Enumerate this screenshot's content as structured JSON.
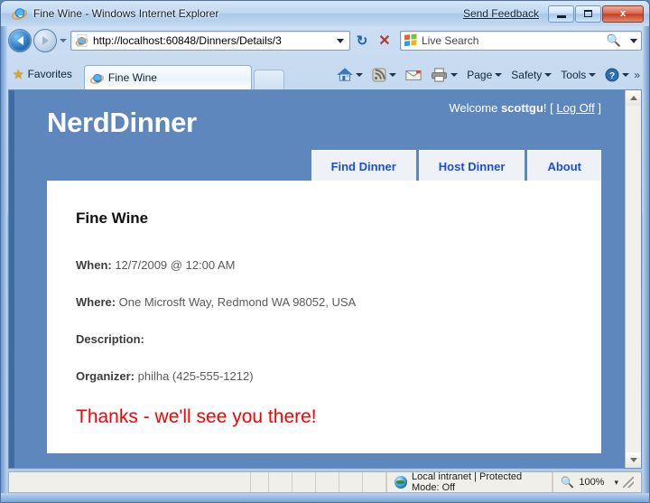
{
  "window": {
    "title": "Fine Wine - Windows Internet Explorer",
    "title_icon": "ie-logo-icon",
    "send_feedback": "Send Feedback",
    "minimize_label": "Minimize",
    "maximize_label": "Maximize",
    "close_label": "x"
  },
  "navigation": {
    "back_label": "Back",
    "forward_label": "Forward",
    "history_label": "Recent Pages",
    "address_value": "http://localhost:60848/Dinners/Details/3",
    "address_placeholder": "http://",
    "refresh_label": "↻",
    "stop_label": "✕",
    "search_placeholder": "Live Search",
    "search_value": "Live Search"
  },
  "tabbar": {
    "favorites_label": "Favorites",
    "tab_title": "Fine Wine",
    "new_tab_label": "",
    "commands": [
      {
        "label": "",
        "icon": "home-icon",
        "caret": true
      },
      {
        "label": "",
        "icon": "feeds-icon",
        "caret": true
      },
      {
        "label": "",
        "icon": "mail-icon",
        "caret": false
      },
      {
        "label": "",
        "icon": "print-icon",
        "caret": true
      },
      {
        "label": "Page",
        "icon": "",
        "caret": true
      },
      {
        "label": "Safety",
        "icon": "",
        "caret": true
      },
      {
        "label": "Tools",
        "icon": "",
        "caret": true
      },
      {
        "label": "",
        "icon": "help-icon",
        "caret": true
      }
    ],
    "overflow_label": "»"
  },
  "site": {
    "logo": "NerdDinner",
    "welcome_prefix": "Welcome ",
    "welcome_user": "scottgu",
    "welcome_suffix": "! [ ",
    "logoff_label": "Log Off",
    "welcome_end": " ]",
    "nav": [
      {
        "label": "Find Dinner"
      },
      {
        "label": "Host Dinner"
      },
      {
        "label": "About"
      }
    ]
  },
  "dinner": {
    "title": "Fine Wine",
    "when_label": "When:",
    "when_value": " 12/7/2009 @ 12:00 AM",
    "where_label": "Where:",
    "where_value": " One Microsft Way, Redmond WA 98052, USA",
    "description_label": "Description:",
    "description_value": "",
    "organizer_label": "Organizer:",
    "organizer_value": " philha (425-555-1212)",
    "thanks_message": "Thanks - we'll see you there!"
  },
  "statusbar": {
    "zone_icon": "globe-icon",
    "zone_text": "Local intranet | Protected Mode: Off",
    "zoom_level": "100%",
    "zoom_caret": "▾"
  },
  "colors": {
    "page_blue": "#5d87bd",
    "stripe_blue": "#3c6ba5",
    "nav_link": "#1a4fd6",
    "thanks_red": "#fa0000",
    "content_white": "#ffffff"
  }
}
